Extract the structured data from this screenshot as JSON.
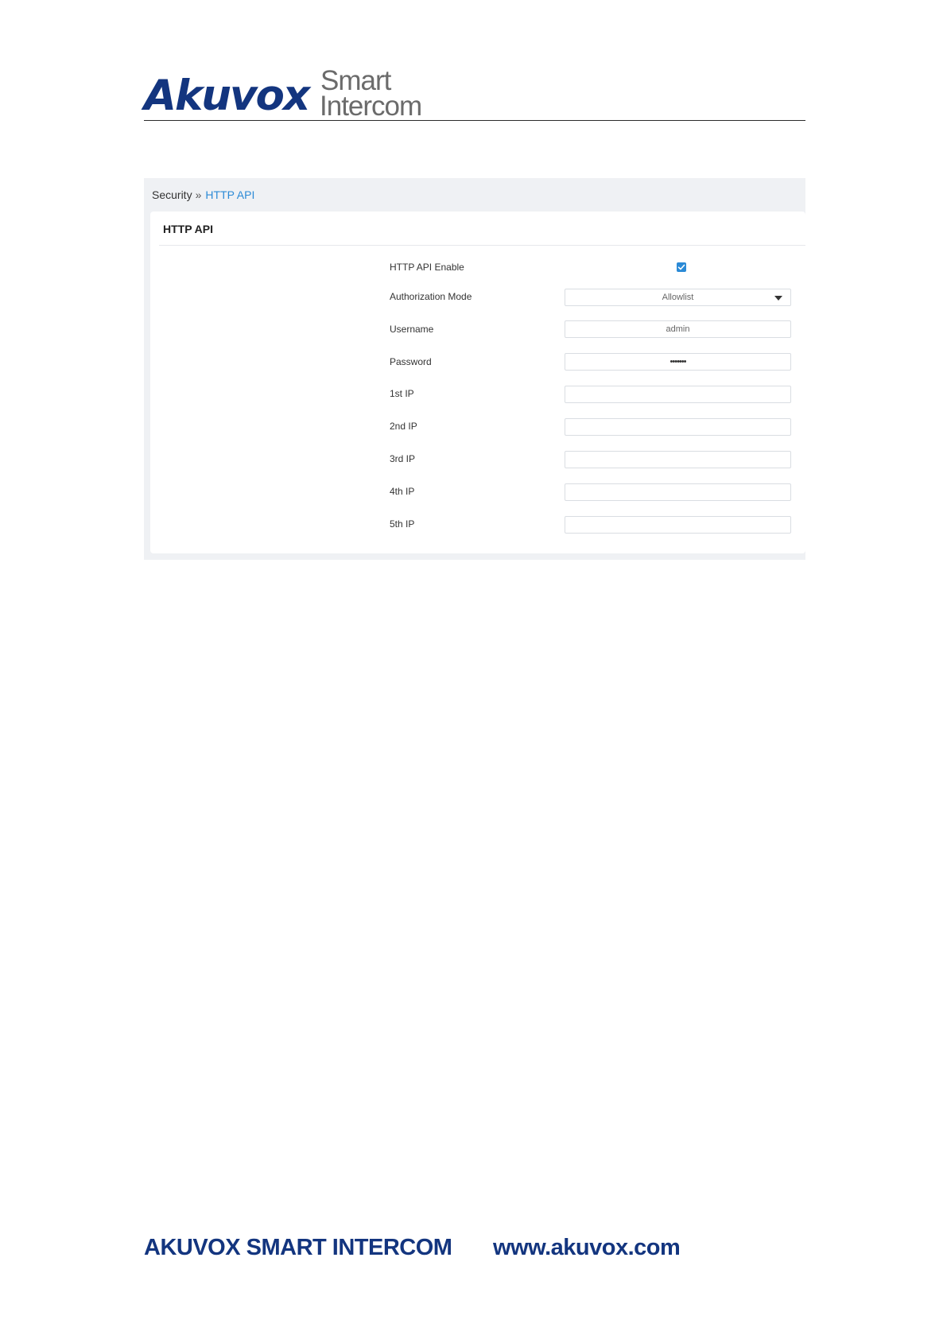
{
  "header": {
    "logo_brand": "Akuvox",
    "logo_line1": "Smart",
    "logo_line2": "Intercom"
  },
  "breadcrumb": {
    "parent": "Security",
    "separator": "»",
    "current": "HTTP API"
  },
  "card": {
    "title": "HTTP API",
    "rows": [
      {
        "label": "HTTP API Enable",
        "type": "checkbox",
        "checked": true
      },
      {
        "label": "Authorization Mode",
        "type": "select",
        "value": "Allowlist"
      },
      {
        "label": "Username",
        "type": "text",
        "value": "admin"
      },
      {
        "label": "Password",
        "type": "password",
        "value": "•••••••"
      },
      {
        "label": "1st IP",
        "type": "text",
        "value": ""
      },
      {
        "label": "2nd IP",
        "type": "text",
        "value": ""
      },
      {
        "label": "3rd IP",
        "type": "text",
        "value": ""
      },
      {
        "label": "4th IP",
        "type": "text",
        "value": ""
      },
      {
        "label": "5th IP",
        "type": "text",
        "value": ""
      }
    ]
  },
  "footer": {
    "company": "AKUVOX SMART INTERCOM",
    "website": "www.akuvox.com"
  },
  "colors": {
    "brand": "#13357f",
    "accent": "#2b8ad6",
    "panel_bg": "#eff1f4"
  }
}
